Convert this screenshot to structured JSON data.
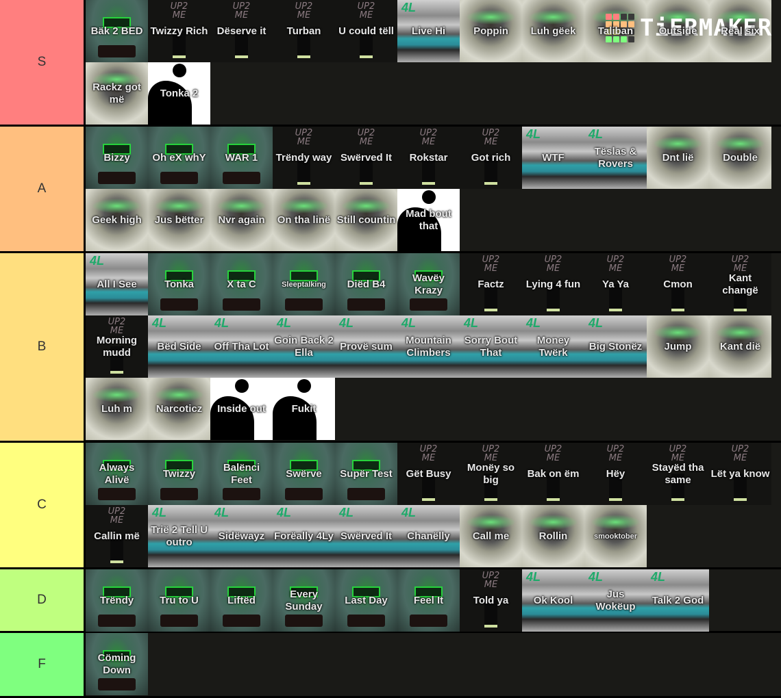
{
  "logo": {
    "text": "TiERMAKER",
    "grid_colors": [
      "#ff7f7f",
      "#ff7f7f",
      "#3a3a3a",
      "#3a3a3a",
      "#ffbf7f",
      "#ffbf7f",
      "#ffbf7f",
      "#ffbf7f",
      "#ffff7f",
      "#ffff7f",
      "#3a3a3a",
      "#3a3a3a",
      "#7fff7f",
      "#7fff7f",
      "#7fff7f",
      "#3a3a3a"
    ]
  },
  "tiers": [
    {
      "label": "S",
      "color": "#ff7f7f",
      "items": [
        {
          "title": "Bäk 2 BED",
          "cover": "bed"
        },
        {
          "title": "Twizzy Rich",
          "cover": "up2"
        },
        {
          "title": "Dëserve it",
          "cover": "up2"
        },
        {
          "title": "Turban",
          "cover": "up2"
        },
        {
          "title": "U could tëll",
          "cover": "up2"
        },
        {
          "title": "Live Hi",
          "cover": "4l"
        },
        {
          "title": "Poppin",
          "cover": "alive"
        },
        {
          "title": "Luh gëek",
          "cover": "alive"
        },
        {
          "title": "Taliban",
          "cover": "alive"
        },
        {
          "title": "Outside",
          "cover": "alive"
        },
        {
          "title": "Rëal six",
          "cover": "alive"
        },
        {
          "title": "Rackz got më",
          "cover": "alive"
        },
        {
          "title": "Tonka 2",
          "cover": "bw"
        }
      ]
    },
    {
      "label": "A",
      "color": "#ffbf7f",
      "items": [
        {
          "title": "Bizzy",
          "cover": "bed"
        },
        {
          "title": "Oh eX whY",
          "cover": "bed"
        },
        {
          "title": "WAR 1",
          "cover": "bed"
        },
        {
          "title": "Trëndy way",
          "cover": "up2"
        },
        {
          "title": "Swërved It",
          "cover": "up2"
        },
        {
          "title": "Rokstar",
          "cover": "up2"
        },
        {
          "title": "Got rich",
          "cover": "up2"
        },
        {
          "title": "WTF",
          "cover": "4l"
        },
        {
          "title": "Tëslas & Rovers",
          "cover": "4l"
        },
        {
          "title": "Dnt lië",
          "cover": "alive"
        },
        {
          "title": "Double",
          "cover": "alive"
        },
        {
          "title": "Geek high",
          "cover": "alive"
        },
        {
          "title": "Jus bëtter",
          "cover": "alive"
        },
        {
          "title": "Nvr again",
          "cover": "alive"
        },
        {
          "title": "On tha linë",
          "cover": "alive"
        },
        {
          "title": "Still countin",
          "cover": "alive"
        },
        {
          "title": "Mad bout that",
          "cover": "bw"
        }
      ]
    },
    {
      "label": "B",
      "color": "#ffdf7f",
      "items": [
        {
          "title": "All I See",
          "cover": "4l"
        },
        {
          "title": "Tonka",
          "cover": "bed"
        },
        {
          "title": "X ta C",
          "cover": "bed"
        },
        {
          "title": "Sleeptalking",
          "cover": "bed",
          "small": true
        },
        {
          "title": "Diëd B4",
          "cover": "bed"
        },
        {
          "title": "Wavëy Krazy",
          "cover": "bed"
        },
        {
          "title": "Factz",
          "cover": "up2"
        },
        {
          "title": "Lying 4 fun",
          "cover": "up2"
        },
        {
          "title": "Ya Ya",
          "cover": "up2"
        },
        {
          "title": "Cmon",
          "cover": "up2"
        },
        {
          "title": "Kant changë",
          "cover": "up2"
        },
        {
          "title": "Morning mudd",
          "cover": "up2"
        },
        {
          "title": "Bëd Side",
          "cover": "4l"
        },
        {
          "title": "Off Tha Lot",
          "cover": "4l"
        },
        {
          "title": "Goin Back 2 Ella",
          "cover": "4l"
        },
        {
          "title": "Provë sum",
          "cover": "4l"
        },
        {
          "title": "Mountain Climbers",
          "cover": "4l"
        },
        {
          "title": "Sorry Bout That",
          "cover": "4l"
        },
        {
          "title": "Money Twërk",
          "cover": "4l"
        },
        {
          "title": "Big Stonëz",
          "cover": "4l"
        },
        {
          "title": "Jump",
          "cover": "alive"
        },
        {
          "title": "Kant dië",
          "cover": "alive"
        },
        {
          "title": "Luh m",
          "cover": "alive"
        },
        {
          "title": "Narcoticz",
          "cover": "alive"
        },
        {
          "title": "Inside out",
          "cover": "bw"
        },
        {
          "title": "Fukit",
          "cover": "bw"
        }
      ]
    },
    {
      "label": "C",
      "color": "#ffff7f",
      "items": [
        {
          "title": "Always Alivë",
          "cover": "bed"
        },
        {
          "title": "Twizzy",
          "cover": "bed"
        },
        {
          "title": "Balënci Feet",
          "cover": "bed"
        },
        {
          "title": "Swërve",
          "cover": "bed"
        },
        {
          "title": "Supër Test",
          "cover": "bed"
        },
        {
          "title": "Gët Busy",
          "cover": "up2"
        },
        {
          "title": "Monëy so big",
          "cover": "up2"
        },
        {
          "title": "Bak on ëm",
          "cover": "up2"
        },
        {
          "title": "Hëy",
          "cover": "up2"
        },
        {
          "title": "Stayëd tha same",
          "cover": "up2"
        },
        {
          "title": "Lët ya know",
          "cover": "up2"
        },
        {
          "title": "Callin më",
          "cover": "up2"
        },
        {
          "title": "Trië 2 Tell U outro",
          "cover": "4l"
        },
        {
          "title": "Sidëwayz",
          "cover": "4l"
        },
        {
          "title": "Forëally 4Ly",
          "cover": "4l"
        },
        {
          "title": "Swërved It",
          "cover": "4l"
        },
        {
          "title": "Chanëlly",
          "cover": "4l"
        },
        {
          "title": "Call me",
          "cover": "alive"
        },
        {
          "title": "Rollin",
          "cover": "alive"
        },
        {
          "title": "smooktober",
          "cover": "alive",
          "small": true
        }
      ]
    },
    {
      "label": "D",
      "color": "#bfff7f",
      "items": [
        {
          "title": "Trëndy",
          "cover": "bed"
        },
        {
          "title": "Tru to U",
          "cover": "bed"
        },
        {
          "title": "Liftëd",
          "cover": "bed"
        },
        {
          "title": "Every Sunday",
          "cover": "bed"
        },
        {
          "title": "Last Day",
          "cover": "bed"
        },
        {
          "title": "Feel It",
          "cover": "bed"
        },
        {
          "title": "Told ya",
          "cover": "up2"
        },
        {
          "title": "Ok Kool",
          "cover": "4l"
        },
        {
          "title": "Jus Wokëup",
          "cover": "4l"
        },
        {
          "title": "Talk 2 God",
          "cover": "4l"
        }
      ]
    },
    {
      "label": "F",
      "color": "#7fff7f",
      "items": [
        {
          "title": "Cöming Down",
          "cover": "bed"
        }
      ]
    }
  ]
}
